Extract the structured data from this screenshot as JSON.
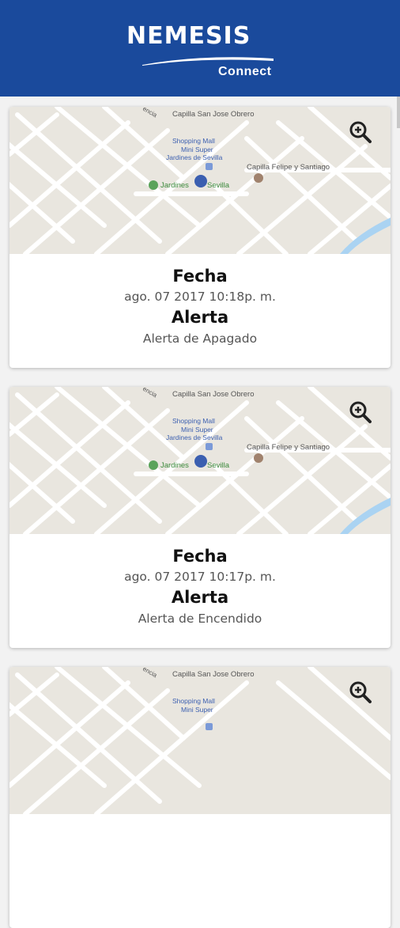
{
  "header": {
    "brand": "NEMESIS",
    "subtitle": "Connect"
  },
  "map_labels": {
    "chapel1": "Capilla San Jose Obrero",
    "mall1": "Shopping Mall",
    "mall2": "Mini Super",
    "mall3": "Jardines de Sevilla",
    "chapel2": "Capilla Felipe y Santiago",
    "park_left": "Jardines",
    "park_right": "Sevilla",
    "road": "encia"
  },
  "cards": [
    {
      "date_label": "Fecha",
      "date_value": "ago. 07 2017 10:18p. m.",
      "alert_label": "Alerta",
      "alert_value": "Alerta de Apagado"
    },
    {
      "date_label": "Fecha",
      "date_value": "ago. 07 2017 10:17p. m.",
      "alert_label": "Alerta",
      "alert_value": "Alerta de Encendido"
    },
    {
      "date_label": "",
      "date_value": "",
      "alert_label": "",
      "alert_value": ""
    }
  ],
  "colors": {
    "header_bg": "#1a4a9c",
    "marker": "#3b5fb0",
    "water": "#aad3f2"
  }
}
